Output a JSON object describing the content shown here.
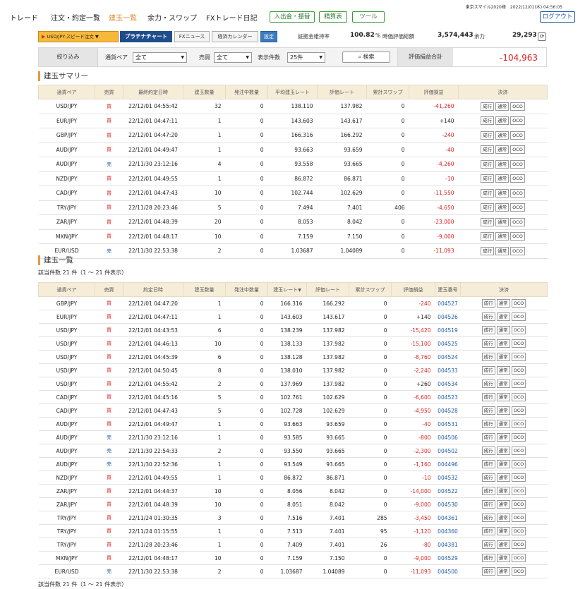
{
  "nav": {
    "items": [
      "トレード",
      "注文・約定一覧",
      "建玉一覧",
      "余力・スワップ",
      "FXトレード日記"
    ],
    "active_index": 2,
    "buttons": [
      "入出金・振替",
      "精算表",
      "ツール"
    ],
    "user": "東京スマイル2020様　2022/12/01(木) 04:56:05",
    "logout": "ログアウト"
  },
  "toolbar": {
    "speed_order": "USD/JPY-スピード注文",
    "platinum_chart": "プラチナチャート",
    "fx_news": "FXニュース",
    "calendar": "経済カレンダー",
    "settings": "設定",
    "margin_ratio_label": "証拠金維持率",
    "margin_ratio_value": "100.82",
    "margin_ratio_unit": "%",
    "valuation_label": "時価評価総額",
    "valuation_value": "3,574,443",
    "buying_power_label": "余力",
    "buying_power_value": "29,293"
  },
  "filter": {
    "title": "絞り込み",
    "pair_label": "通貨ペア",
    "pair_value": "全て",
    "side_label": "売買",
    "side_value": "全て",
    "count_label": "表示件数",
    "count_value": "25件",
    "search": "検索"
  },
  "pnl_total": {
    "label": "評価損益合計",
    "value": "-104,963"
  },
  "summary": {
    "title": "建玉サマリー",
    "headers": [
      "通貨ペア",
      "売買",
      "最終約定日時",
      "建玉数量",
      "発注中数量",
      "平均建玉レート",
      "評価レート",
      "累計スワップ",
      "評価損益",
      "決済"
    ],
    "rows": [
      [
        "USD/JPY",
        "買",
        "22/12/01 04:55:42",
        "32",
        "0",
        "138.110",
        "137.982",
        "0",
        "-41,260"
      ],
      [
        "EUR/JPY",
        "買",
        "22/12/01 04:47:11",
        "1",
        "0",
        "143.603",
        "143.617",
        "0",
        "+140"
      ],
      [
        "GBP/JPY",
        "買",
        "22/12/01 04:47:20",
        "1",
        "0",
        "166.316",
        "166.292",
        "0",
        "-240"
      ],
      [
        "AUD/JPY",
        "買",
        "22/12/01 04:49:47",
        "1",
        "0",
        "93.663",
        "93.659",
        "0",
        "-40"
      ],
      [
        "AUD/JPY",
        "売",
        "22/11/30 23:12:16",
        "4",
        "0",
        "93.558",
        "93.665",
        "0",
        "-4,260"
      ],
      [
        "NZD/JPY",
        "買",
        "22/12/01 04:49:55",
        "1",
        "0",
        "86.872",
        "86.871",
        "0",
        "-10"
      ],
      [
        "CAD/JPY",
        "買",
        "22/12/01 04:47:43",
        "10",
        "0",
        "102.744",
        "102.629",
        "0",
        "-11,550"
      ],
      [
        "TRY/JPY",
        "買",
        "22/11/28 20:23:46",
        "5",
        "0",
        "7.494",
        "7.401",
        "406",
        "-4,650"
      ],
      [
        "ZAR/JPY",
        "買",
        "22/12/01 04:48:39",
        "20",
        "0",
        "8.053",
        "8.042",
        "0",
        "-23,000"
      ],
      [
        "MXN/JPY",
        "買",
        "22/12/01 04:48:17",
        "10",
        "0",
        "7.159",
        "7.150",
        "0",
        "-9,000"
      ],
      [
        "EUR/USD",
        "売",
        "22/11/30 22:53:38",
        "2",
        "0",
        "1.03687",
        "1.04089",
        "0",
        "-11,093"
      ]
    ]
  },
  "actions": [
    "成行",
    "通常",
    "OCO"
  ],
  "positions": {
    "title": "建玉一覧",
    "count_text": "該当件数 21 件（1 ～ 21 件表示）",
    "sort_mark": "▼",
    "headers": [
      "通貨ペア",
      "売買",
      "約定日時",
      "建玉数量",
      "発注中数量",
      "建玉レート",
      "評価レート",
      "累計スワップ",
      "評価損益",
      "建玉番号",
      "決済"
    ],
    "rows": [
      [
        "GBP/JPY",
        "買",
        "22/12/01 04:47:20",
        "1",
        "0",
        "166.316",
        "166.292",
        "0",
        "-240",
        "004527"
      ],
      [
        "EUR/JPY",
        "買",
        "22/12/01 04:47:11",
        "1",
        "0",
        "143.603",
        "143.617",
        "0",
        "+140",
        "004526"
      ],
      [
        "USD/JPY",
        "買",
        "22/12/01 04:43:53",
        "6",
        "0",
        "138.239",
        "137.982",
        "0",
        "-15,420",
        "004519"
      ],
      [
        "USD/JPY",
        "買",
        "22/12/01 04:46:13",
        "10",
        "0",
        "138.133",
        "137.982",
        "0",
        "-15,100",
        "004525"
      ],
      [
        "USD/JPY",
        "買",
        "22/12/01 04:45:39",
        "6",
        "0",
        "138.128",
        "137.982",
        "0",
        "-8,760",
        "004524"
      ],
      [
        "USD/JPY",
        "買",
        "22/12/01 04:50:45",
        "8",
        "0",
        "138.010",
        "137.982",
        "0",
        "-2,240",
        "004533"
      ],
      [
        "USD/JPY",
        "買",
        "22/12/01 04:55:42",
        "2",
        "0",
        "137.969",
        "137.982",
        "0",
        "+260",
        "004534"
      ],
      [
        "CAD/JPY",
        "買",
        "22/12/01 04:45:16",
        "5",
        "0",
        "102.761",
        "102.629",
        "0",
        "-6,600",
        "004523"
      ],
      [
        "CAD/JPY",
        "買",
        "22/12/01 04:47:43",
        "5",
        "0",
        "102.728",
        "102.629",
        "0",
        "-4,950",
        "004528"
      ],
      [
        "AUD/JPY",
        "買",
        "22/12/01 04:49:47",
        "1",
        "0",
        "93.663",
        "93.659",
        "0",
        "-40",
        "004531"
      ],
      [
        "AUD/JPY",
        "売",
        "22/11/30 23:12:16",
        "1",
        "0",
        "93.585",
        "93.665",
        "0",
        "-800",
        "004506"
      ],
      [
        "AUD/JPY",
        "売",
        "22/11/30 22:54:33",
        "2",
        "0",
        "93.550",
        "93.665",
        "0",
        "-2,300",
        "004502"
      ],
      [
        "AUD/JPY",
        "売",
        "22/11/30 22:52:36",
        "1",
        "0",
        "93.549",
        "93.665",
        "0",
        "-1,160",
        "004496"
      ],
      [
        "NZD/JPY",
        "買",
        "22/12/01 04:49:55",
        "1",
        "0",
        "86.872",
        "86.871",
        "0",
        "-10",
        "004532"
      ],
      [
        "ZAR/JPY",
        "買",
        "22/12/01 04:44:37",
        "10",
        "0",
        "8.056",
        "8.042",
        "0",
        "-14,000",
        "004522"
      ],
      [
        "ZAR/JPY",
        "買",
        "22/12/01 04:48:39",
        "10",
        "0",
        "8.051",
        "8.042",
        "0",
        "-9,000",
        "004530"
      ],
      [
        "TRY/JPY",
        "買",
        "22/11/24 01:30:35",
        "3",
        "0",
        "7.516",
        "7.401",
        "285",
        "-3,450",
        "004361"
      ],
      [
        "TRY/JPY",
        "買",
        "22/11/24 01:15:55",
        "1",
        "0",
        "7.513",
        "7.401",
        "95",
        "-1,120",
        "004360"
      ],
      [
        "TRY/JPY",
        "買",
        "22/11/28 20:23:46",
        "1",
        "0",
        "7.409",
        "7.401",
        "26",
        "-80",
        "004381"
      ],
      [
        "MXN/JPY",
        "買",
        "22/12/01 04:48:17",
        "10",
        "0",
        "7.159",
        "7.150",
        "0",
        "-9,000",
        "004529"
      ],
      [
        "EUR/USD",
        "売",
        "22/11/30 22:53:38",
        "2",
        "0",
        "1.03687",
        "1.04089",
        "0",
        "-11,093",
        "004500"
      ]
    ]
  },
  "colors": {
    "accent": "#e08a2c",
    "negative": "#dd2222",
    "link": "#1e5aa8",
    "header_bg": "#f6edd9"
  }
}
